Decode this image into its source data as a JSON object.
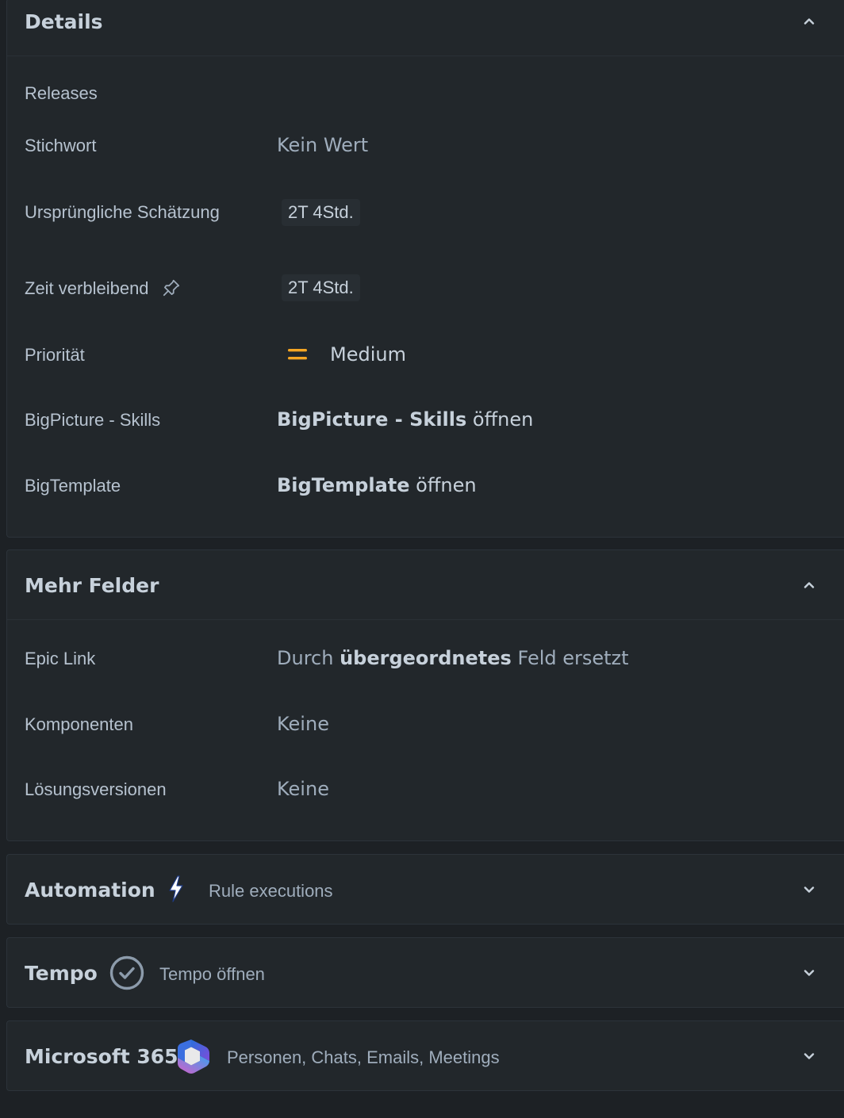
{
  "details": {
    "title": "Details",
    "fields": {
      "releases": {
        "label": "Releases"
      },
      "stichwort": {
        "label": "Stichwort",
        "value": "Kein Wert"
      },
      "schaetzung": {
        "label": "Ursprüngliche Schätzung",
        "value": "2T 4Std."
      },
      "zeit": {
        "label": "Zeit verbleibend",
        "value": "2T 4Std."
      },
      "prioritaet": {
        "label": "Priorität",
        "value": "Medium"
      },
      "bigpicture": {
        "label": "BigPicture - Skills",
        "value_bold": "BigPicture - Skills",
        "value_rest": " öffnen"
      },
      "bigtemplate": {
        "label": "BigTemplate",
        "value_bold": "BigTemplate",
        "value_rest": " öffnen"
      }
    }
  },
  "more_fields": {
    "title": "Mehr Felder",
    "fields": {
      "epic": {
        "label": "Epic Link",
        "value_pre": "Durch ",
        "value_bold": "übergeordnetes",
        "value_post": " Feld ersetzt"
      },
      "komponenten": {
        "label": "Komponenten",
        "value": "Keine"
      },
      "loesung": {
        "label": "Lösungsversionen",
        "value": "Keine"
      }
    }
  },
  "automation": {
    "title": "Automation",
    "subtitle": "Rule executions"
  },
  "tempo": {
    "title": "Tempo",
    "subtitle": "Tempo öffnen"
  },
  "m365": {
    "title": "Microsoft 365",
    "subtitle": "Personen, Chats, Emails, Meetings"
  },
  "colors": {
    "background": "#1d2125",
    "panel": "#22272b",
    "text": "#b6c2cf",
    "priority_medium": "#f5a623",
    "tempo_ring": "#8c9bab"
  },
  "icons": {
    "collapse": "chevron-up-icon",
    "expand": "chevron-down-icon",
    "pin": "pin-icon",
    "priority": "priority-medium-icon",
    "automation": "lightning-bolt-icon",
    "tempo": "check-circle-icon",
    "m365": "microsoft-365-logo"
  }
}
